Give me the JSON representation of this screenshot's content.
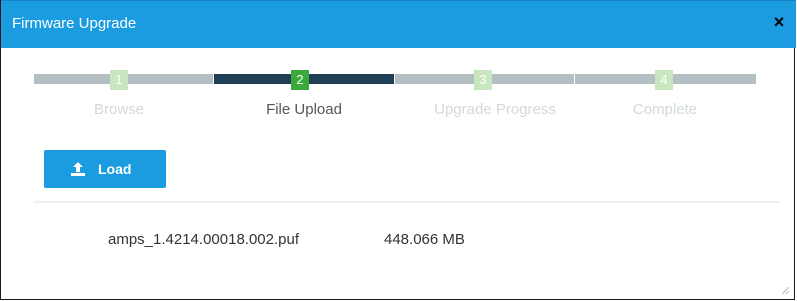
{
  "dialog": {
    "title": "Firmware Upgrade",
    "close_glyph": "×"
  },
  "wizard": {
    "current_step": 2,
    "steps": [
      {
        "number": "1",
        "label": "Browse",
        "state": "done"
      },
      {
        "number": "2",
        "label": "File Upload",
        "state": "active"
      },
      {
        "number": "3",
        "label": "Upgrade Progress",
        "state": "pending"
      },
      {
        "number": "4",
        "label": "Complete",
        "state": "pending"
      }
    ]
  },
  "toolbar": {
    "load_label": "Load",
    "load_icon": "upload-icon"
  },
  "file": {
    "name": "amps_1.4214.00018.002.puf",
    "size": "448.066 MB"
  },
  "colors": {
    "accent": "#1b9be0",
    "track_inactive": "#b4bfc4",
    "track_active": "#1e3f54",
    "badge_active": "#3aa83a",
    "badge_inactive": "#c8e6c0",
    "label_active": "#555555",
    "label_inactive": "#d3d8db"
  }
}
